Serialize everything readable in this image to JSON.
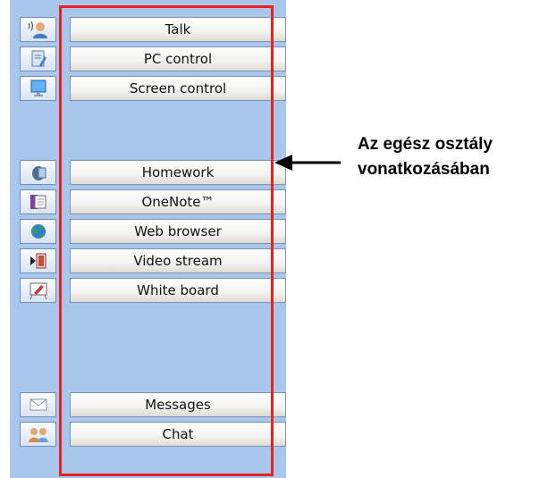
{
  "toolbar": {
    "group1": [
      {
        "label": "Talk",
        "icon": "talk-icon"
      },
      {
        "label": "PC control",
        "icon": "pc-control-icon"
      },
      {
        "label": "Screen control",
        "icon": "screen-control-icon"
      }
    ],
    "group2": [
      {
        "label": "Homework",
        "icon": "homework-icon"
      },
      {
        "label": "OneNote™",
        "icon": "onenote-icon"
      },
      {
        "label": "Web browser",
        "icon": "web-browser-icon"
      },
      {
        "label": "Video stream",
        "icon": "video-stream-icon"
      },
      {
        "label": "White board",
        "icon": "white-board-icon"
      }
    ],
    "group3": [
      {
        "label": "Messages",
        "icon": "messages-icon"
      },
      {
        "label": "Chat",
        "icon": "chat-icon"
      }
    ]
  },
  "annotation": {
    "line1": "Az egész osztály",
    "line2": "vonatkozásában"
  },
  "colors": {
    "panel": "#a9c6ec",
    "highlight_box": "#e8201f"
  }
}
